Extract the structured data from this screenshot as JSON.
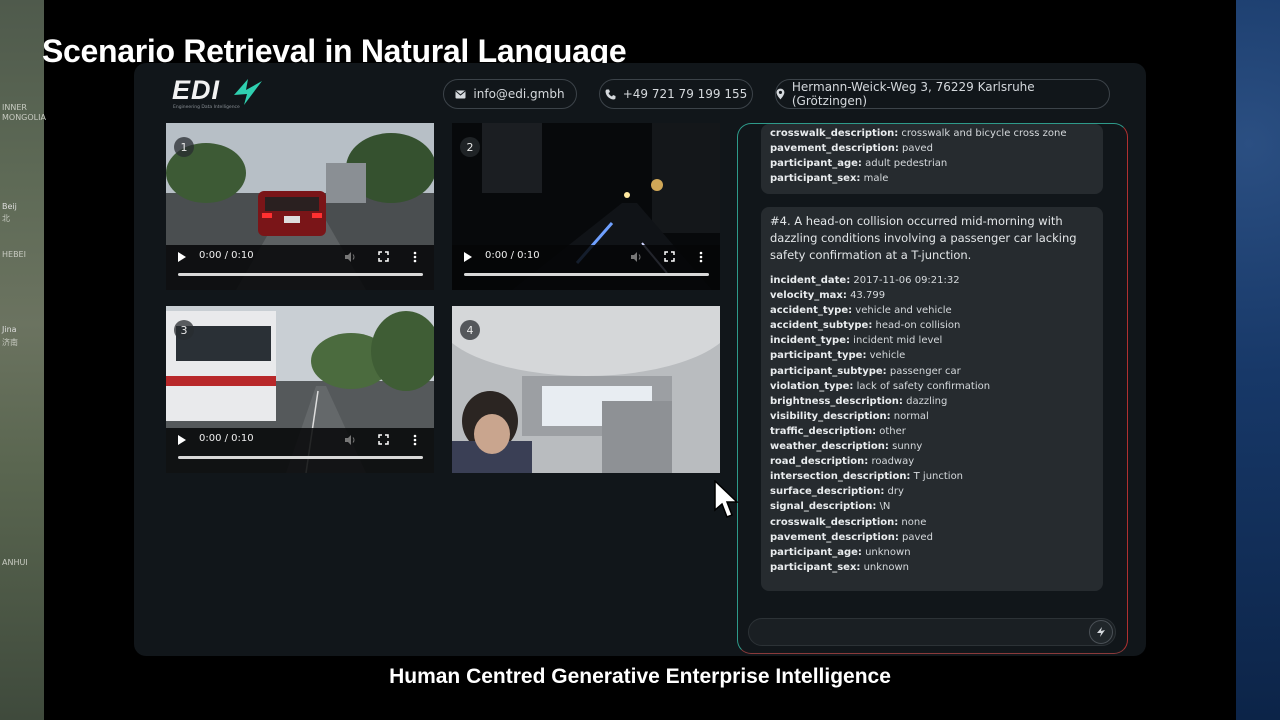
{
  "headline": "Scenario Retrieval in Natural Language",
  "footer_caption": "Human Centred Generative Enterprise Intelligence",
  "map_labels": [
    "INNER",
    "MONGOLIA",
    "Beij",
    "北",
    "HEBEI",
    "Jina",
    "济南",
    "ANHUI"
  ],
  "logo": {
    "text": "EDI",
    "tagline": "Engineering Data Intelligence",
    "accent": "#2fd0b0"
  },
  "header": {
    "email": "info@edi.gmbh",
    "phone": "+49 721 79 199 155",
    "address": "Hermann-Weick-Weg 3, 76229 Karlsruhe (Grötzingen)"
  },
  "videos": [
    {
      "number": "1",
      "time": "0:00 / 0:10"
    },
    {
      "number": "2",
      "time": "0:00 / 0:10"
    },
    {
      "number": "3",
      "time": "0:00 / 0:10"
    },
    {
      "number": "4"
    }
  ],
  "results": {
    "prev_rows": [
      {
        "key": "crosswalk_description:",
        "value": "crosswalk and bicycle cross zone"
      },
      {
        "key": "pavement_description:",
        "value": "paved"
      },
      {
        "key": "participant_age:",
        "value": "adult pedestrian"
      },
      {
        "key": "participant_sex:",
        "value": "male"
      }
    ],
    "card4": {
      "heading": "#4. A head-on collision occurred mid-morning with dazzling conditions involving a passenger car lacking safety confirmation at a T-junction.",
      "rows": [
        {
          "key": "incident_date:",
          "value": "2017-11-06 09:21:32"
        },
        {
          "key": "velocity_max:",
          "value": "43.799"
        },
        {
          "key": "accident_type:",
          "value": "vehicle and vehicle"
        },
        {
          "key": "accident_subtype:",
          "value": "head-on collision"
        },
        {
          "key": "incident_type:",
          "value": "incident mid level"
        },
        {
          "key": "participant_type:",
          "value": "vehicle"
        },
        {
          "key": "participant_subtype:",
          "value": "passenger car"
        },
        {
          "key": "violation_type:",
          "value": "lack of safety confirmation"
        },
        {
          "key": "brightness_description:",
          "value": "dazzling"
        },
        {
          "key": "visibility_description:",
          "value": "normal"
        },
        {
          "key": "traffic_description:",
          "value": "other"
        },
        {
          "key": "weather_description:",
          "value": "sunny"
        },
        {
          "key": "road_description:",
          "value": "roadway"
        },
        {
          "key": "intersection_description:",
          "value": "T junction"
        },
        {
          "key": "surface_description:",
          "value": "dry"
        },
        {
          "key": "signal_description:",
          "value": "\\N"
        },
        {
          "key": "crosswalk_description:",
          "value": "none"
        },
        {
          "key": "pavement_description:",
          "value": "paved"
        },
        {
          "key": "participant_age:",
          "value": "unknown"
        },
        {
          "key": "participant_sex:",
          "value": "unknown"
        }
      ]
    }
  },
  "chat_input": {
    "value": ""
  },
  "icons": {
    "email": "mail-icon",
    "phone": "phone-icon",
    "address": "location-pin-icon",
    "send": "lightning-icon",
    "play": "play-icon",
    "volume": "volume-icon",
    "fullscreen": "fullscreen-icon",
    "more": "more-vertical-icon",
    "cursor": "mouse-pointer-icon"
  }
}
